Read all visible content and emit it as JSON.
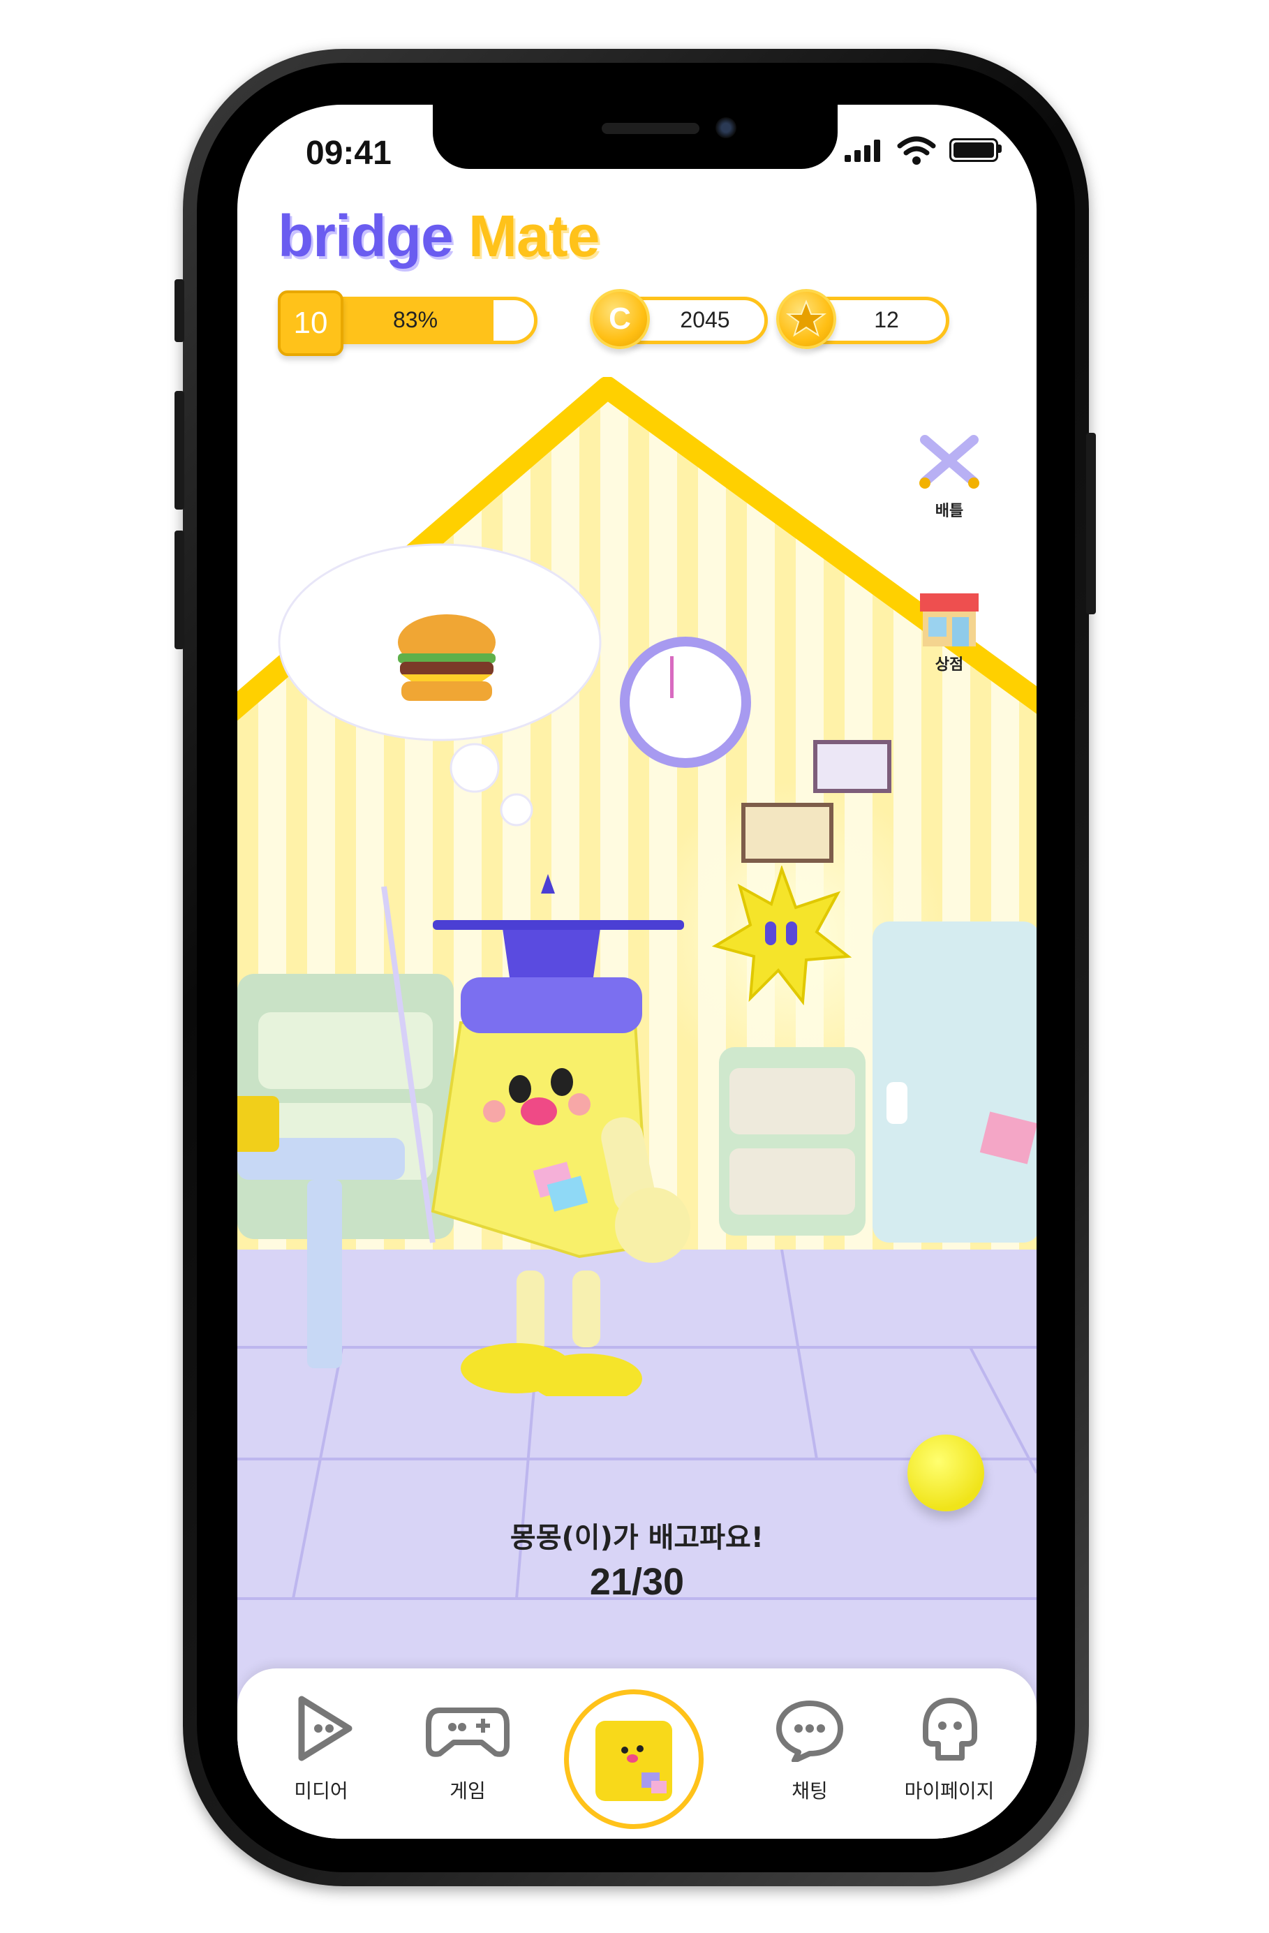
{
  "status_bar": {
    "time": "09:41"
  },
  "app": {
    "logo_word1": "bridge",
    "logo_word2": "Mate",
    "colors": {
      "primary": "#ffc21a",
      "accent": "#6a5cf0",
      "floor": "#d8d4f6"
    }
  },
  "stats": {
    "level": "10",
    "exp_percent_label": "83%",
    "exp_progress": 0.83,
    "coin_icon_letter": "C",
    "coins": "2045",
    "stars": "12"
  },
  "side_menu": [
    {
      "label": "배틀",
      "icon": "crossed-swords-icon"
    },
    {
      "label": "상점",
      "icon": "shop-icon"
    }
  ],
  "pet": {
    "status_message": "몽몽(이)가 배고파요!",
    "hunger_count": "21/30",
    "thought": "hamburger-icon"
  },
  "bottom_nav": [
    {
      "label": "미디어",
      "icon": "play-icon"
    },
    {
      "label": "게임",
      "icon": "gamepad-icon"
    },
    {
      "label": "",
      "icon": "pet-home-icon"
    },
    {
      "label": "채팅",
      "icon": "chat-icon"
    },
    {
      "label": "마이페이지",
      "icon": "profile-icon"
    }
  ]
}
